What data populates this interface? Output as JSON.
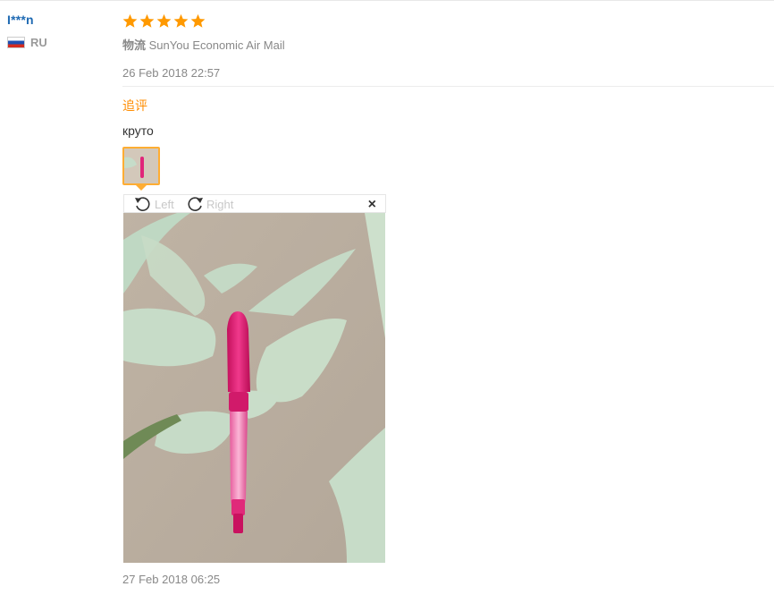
{
  "reviewer": {
    "name": "I***n",
    "country_code": "RU",
    "flag_icon": "russia-flag-icon"
  },
  "review": {
    "rating": 5,
    "star_color": "#ff9900",
    "logistics_label": "物流",
    "logistics_value": "SunYou Economic Air Mail",
    "date": "26 Feb 2018 22:57"
  },
  "followup": {
    "label": "追评",
    "label_color": "#ff8c00",
    "text": "круто",
    "viewer": {
      "rotate_left_label": "Left",
      "rotate_right_label": "Right",
      "close_symbol": "×"
    },
    "date": "27 Feb 2018 06:25"
  }
}
